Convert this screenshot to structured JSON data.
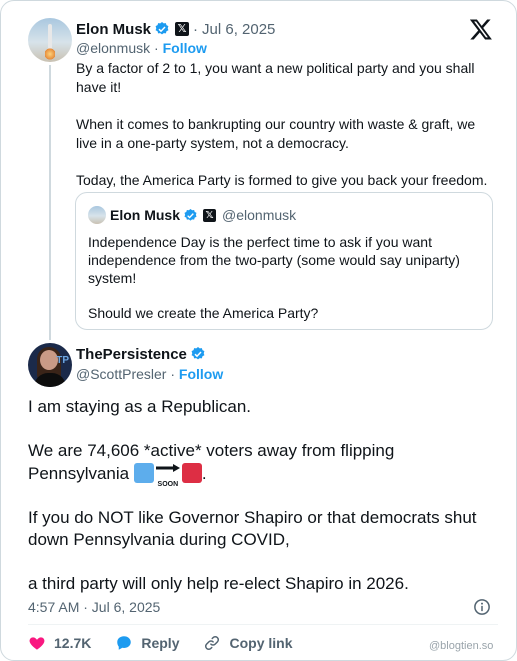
{
  "parent": {
    "name": "Elon Musk",
    "date": "Jul 6, 2025",
    "handle": "@elonmusk",
    "follow_label": "Follow",
    "paragraphs": [
      "By a factor of 2 to 1, you want a new political party and you shall have it!",
      "When it comes to bankrupting our country with waste & graft, we live in a one-party system, not a democracy.",
      "Today, the America Party is formed to give you back your freedom."
    ],
    "quote": {
      "name": "Elon Musk",
      "handle": "@elonmusk",
      "paragraphs": [
        "Independence Day is the perfect time to ask if you want independence from the two-party (some would say uniparty) system!",
        "Should we create the America Party?"
      ]
    }
  },
  "main": {
    "name": "ThePersistence",
    "handle": "@ScottPresler",
    "follow_label": "Follow",
    "line1": "I am staying as a Republican.",
    "line2_prefix": "We are 74,606 *active* voters away from flipping Pennsylvania ",
    "line2_suffix": ".",
    "emoji_soon_label": "SOON",
    "line3": "If you do NOT like Governor Shapiro or that democrats shut down Pennsylvania during COVID,",
    "line4": "a third party will only help re-elect Shapiro in 2026.",
    "timestamp": "4:57 AM · Jul 6, 2025"
  },
  "actions": {
    "likes": "12.7K",
    "reply_label": "Reply",
    "copy_link_label": "Copy link"
  },
  "watermark": "@blogtien.so",
  "icons": {
    "x_logo": "x-logo-icon",
    "verified": "verified-badge-icon",
    "info": "info-icon",
    "heart": "heart-icon",
    "reply": "reply-bubble-icon",
    "link": "link-icon"
  },
  "colors": {
    "accent": "#1d9bf0",
    "like": "#f91880",
    "muted": "#536471"
  }
}
